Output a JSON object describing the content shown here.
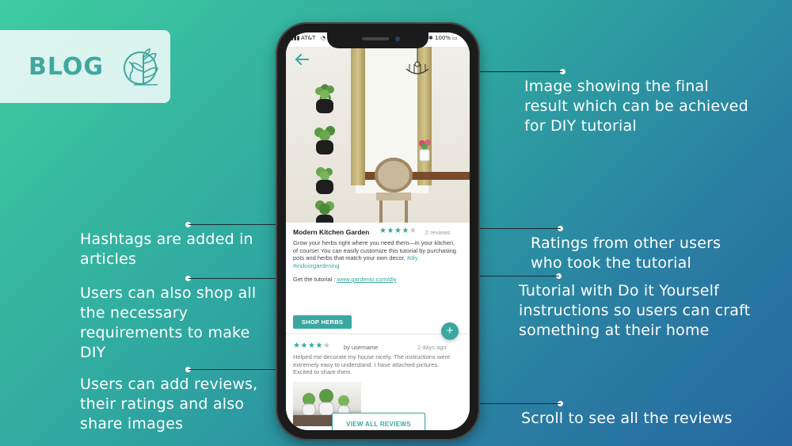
{
  "badge": {
    "title": "BLOG",
    "icon": "globe-plant-icon"
  },
  "annotations": {
    "image_result": "Image showing the final result which can be achieved for DIY tutorial",
    "ratings": "Ratings from other users who took the tutorial",
    "tutorial": "Tutorial with Do it Yourself instructions so users can craft something at their home",
    "scroll": "Scroll to see all the reviews",
    "hashtags": "Hashtags are added in articles",
    "shop": "Users can also shop all the necessary requirements to make  DIY",
    "reviews": "Users can add reviews, their ratings and also share images"
  },
  "phone": {
    "status": {
      "carrier": "AT&T",
      "battery": "100%"
    },
    "article": {
      "title": "Modern Kitchen Garden",
      "rating": 4,
      "rating_max": 5,
      "review_count": "2 reviews",
      "description": "Grow your herbs right where you need them—in your kitchen, of course! You can easily customize this tutorial by purchasing pots and herbs that match your own decor.",
      "hashtags": "#diy #indoorgardening",
      "tutorial_label": "Get the tutorial :",
      "tutorial_link": "www.gardenio.com/diy",
      "shop_button": "SHOP HERBS"
    },
    "review": {
      "rating": 4,
      "rating_max": 5,
      "author": "by username",
      "time": "2 days ago",
      "text": "Helped me decorate my house nicely. The instructions were extremely easy to understand. I have attached pictures. Excited to share them."
    },
    "view_all_button": "VIEW ALL REVIEWS",
    "fab_label": "+"
  },
  "colors": {
    "accent": "#3aa8a0",
    "annotation_text": "#ffffff"
  }
}
